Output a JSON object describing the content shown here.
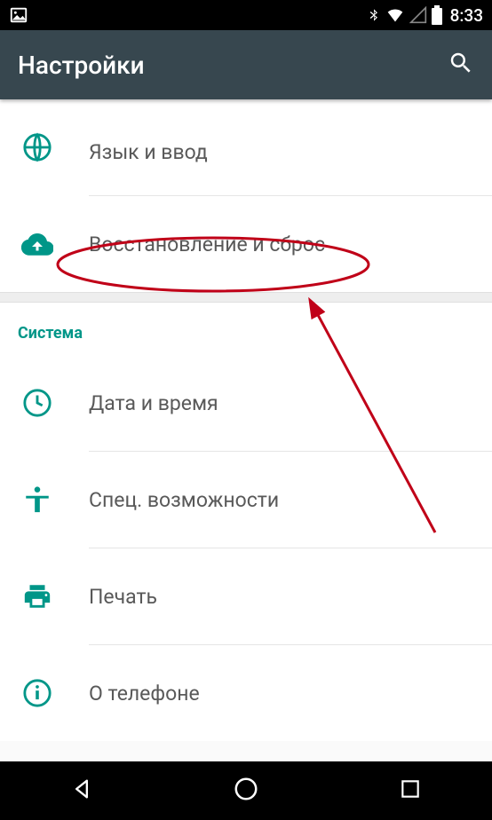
{
  "status_bar": {
    "time": "8:33"
  },
  "app_bar": {
    "title": "Настройки"
  },
  "items_top": [
    {
      "label": "Язык и ввод",
      "icon": "globe"
    },
    {
      "label": "Восстановление и сброс",
      "icon": "backup"
    }
  ],
  "section_system": {
    "header": "Система",
    "items": [
      {
        "label": "Дата и время",
        "icon": "clock"
      },
      {
        "label": "Спец. возможности",
        "icon": "accessibility"
      },
      {
        "label": "Печать",
        "icon": "print"
      },
      {
        "label": "О телефоне",
        "icon": "info"
      }
    ]
  },
  "annotation": {
    "highlight_item_index": 1,
    "color": "#c00018"
  }
}
